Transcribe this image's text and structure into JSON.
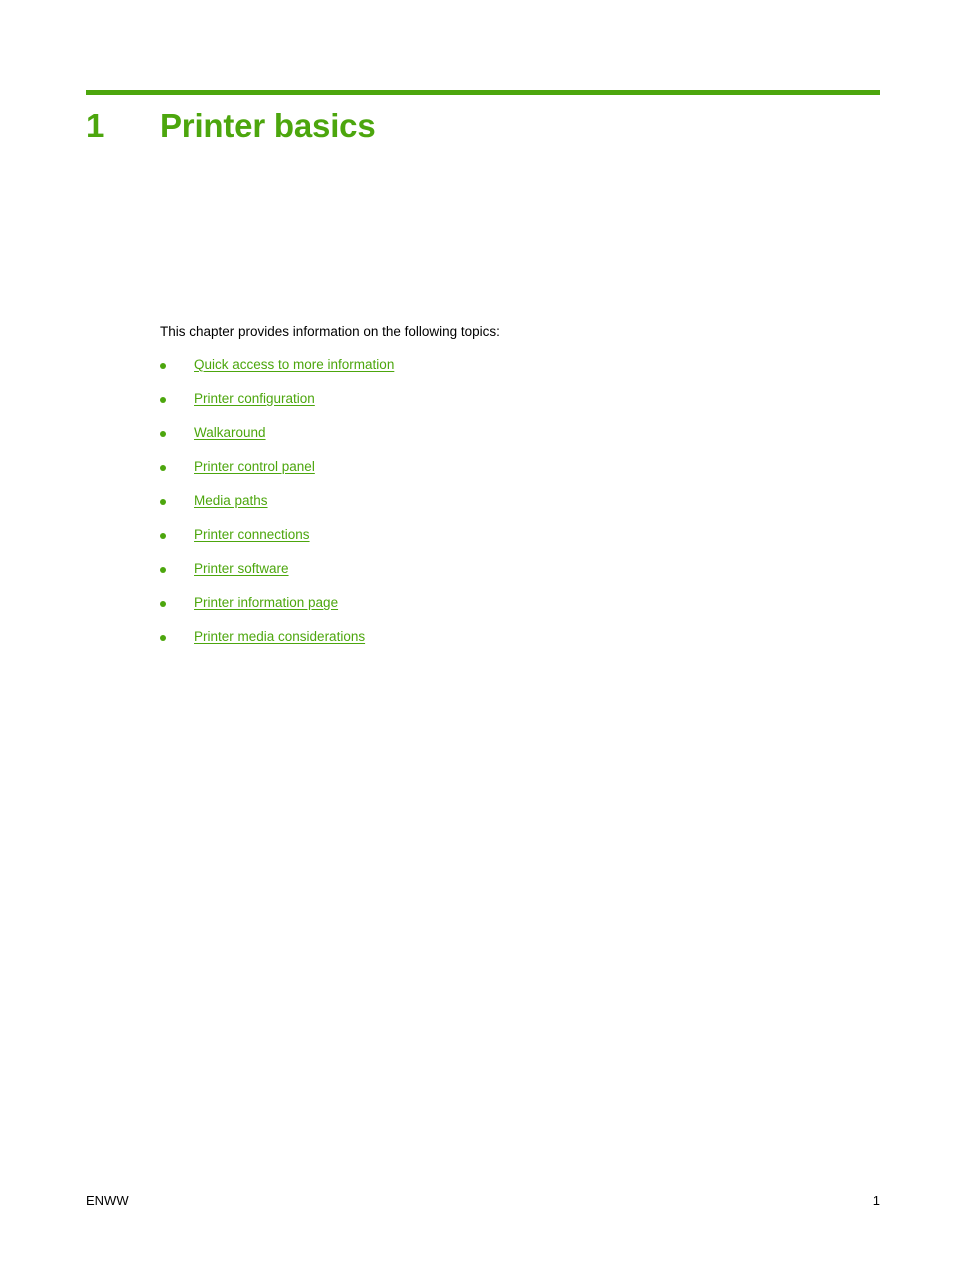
{
  "colors": {
    "accent_green": "#4ca60d",
    "body_text": "#000000",
    "page_background": "#ffffff"
  },
  "chapter": {
    "number": "1",
    "title": "Printer basics"
  },
  "intro": {
    "text": "This chapter provides information on the following topics:"
  },
  "topics": [
    {
      "label": "Quick access to more information"
    },
    {
      "label": "Printer configuration"
    },
    {
      "label": "Walkaround"
    },
    {
      "label": "Printer control panel"
    },
    {
      "label": "Media paths"
    },
    {
      "label": "Printer connections"
    },
    {
      "label": "Printer software"
    },
    {
      "label": "Printer information page"
    },
    {
      "label": "Printer media considerations"
    }
  ],
  "footer": {
    "left_label": "ENWW",
    "page_number": "1"
  }
}
